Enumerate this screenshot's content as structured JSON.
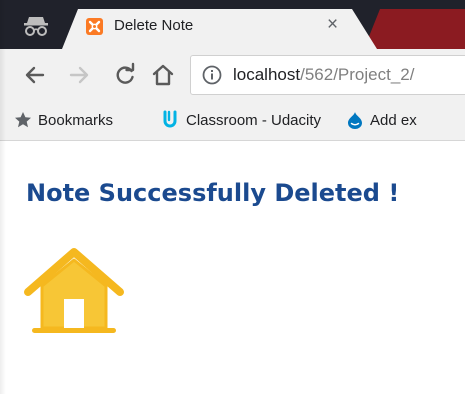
{
  "browser": {
    "active_tab": {
      "title": "Delete Note",
      "close_glyph": "×"
    },
    "address_bar": {
      "host": "localhost",
      "path": "/562/Project_2/"
    },
    "bookmarks": [
      {
        "label": "Bookmarks",
        "icon": "star-icon"
      },
      {
        "label": "Classroom - Udacity",
        "icon": "udacity-icon"
      },
      {
        "label": "Add ex",
        "icon": "drupal-icon"
      }
    ]
  },
  "page": {
    "heading": "Note Successfully Deleted !",
    "home_link_icon": "home-icon"
  },
  "colors": {
    "heading": "#1b4a8f",
    "home_icon": "#f5b81f",
    "tab_favicon": "#fb7a24",
    "chrome_frame": "#20222b",
    "toolbar": "#f1f1f1"
  }
}
